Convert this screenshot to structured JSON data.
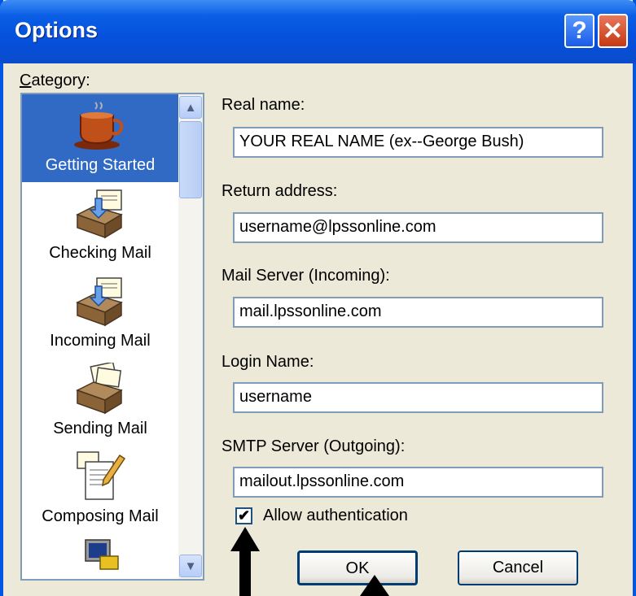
{
  "window": {
    "title": "Options"
  },
  "titlebar": {
    "help_glyph": "?",
    "close_glyph": "✕"
  },
  "category": {
    "label": "Category:",
    "items": [
      {
        "label": "Getting Started",
        "icon": "coffee-cup-icon",
        "selected": true
      },
      {
        "label": "Checking Mail",
        "icon": "mailbox-check-icon",
        "selected": false
      },
      {
        "label": "Incoming Mail",
        "icon": "mailbox-incoming-icon",
        "selected": false
      },
      {
        "label": "Sending Mail",
        "icon": "mailbox-sending-icon",
        "selected": false
      },
      {
        "label": "Composing Mail",
        "icon": "compose-document-icon",
        "selected": false
      },
      {
        "label": "",
        "icon": "computer-icon",
        "selected": false
      }
    ]
  },
  "form": {
    "real_name": {
      "label": "Real name:",
      "value": "YOUR REAL NAME (ex--George Bush)"
    },
    "return_address": {
      "label": "Return address:",
      "value": "username@lpssonline.com"
    },
    "mail_server": {
      "label": "Mail Server (Incoming):",
      "value": "mail.lpssonline.com"
    },
    "login_name": {
      "label": "Login Name:",
      "value": "username"
    },
    "smtp_server": {
      "label": "SMTP Server (Outgoing):",
      "value": "mailout.lpssonline.com"
    },
    "allow_auth": {
      "label": "Allow authentication",
      "checked": true
    }
  },
  "buttons": {
    "ok": "OK",
    "cancel": "Cancel"
  },
  "colors": {
    "title_bar": "#0550dc",
    "selection": "#316ac5",
    "dialog_bg": "#ece9d8"
  }
}
